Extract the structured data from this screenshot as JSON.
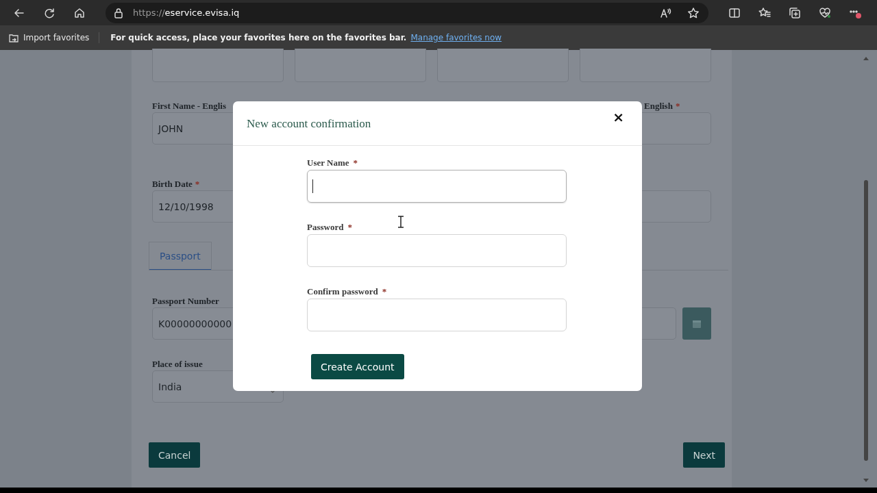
{
  "browser": {
    "url_scheme": "https://",
    "url_host": "eservice.evisa.iq",
    "import_favorites": "Import favorites",
    "favorites_hint": "For quick access, place your favorites here on the favorites bar.",
    "manage_link": "Manage favorites now"
  },
  "form": {
    "top_fields": [
      {
        "kind": "input"
      },
      {
        "kind": "input"
      },
      {
        "kind": "input"
      },
      {
        "kind": "input"
      }
    ],
    "row1": {
      "left_label": "First Name - Englis",
      "left_value": "JOHN",
      "right_label": "English",
      "right_required": "*"
    },
    "row2": {
      "left_label": "Birth Date",
      "left_required": "*",
      "left_value": "12/10/1998"
    },
    "tabs": [
      {
        "label": "Passport",
        "selected": true
      }
    ],
    "row3": {
      "left_label": "Passport Number",
      "left_value": "K00000000000"
    },
    "row4": {
      "left_label": "Place of issue",
      "left_value": "India"
    },
    "cancel": "Cancel",
    "next": "Next"
  },
  "modal": {
    "title": "New account confirmation",
    "close": "×",
    "fields": [
      {
        "label": "User Name",
        "required": "*",
        "focused": true
      },
      {
        "label": "Password",
        "required": "*",
        "focused": false
      },
      {
        "label": "Confirm password",
        "required": "*",
        "focused": false
      }
    ],
    "submit": "Create Account"
  }
}
